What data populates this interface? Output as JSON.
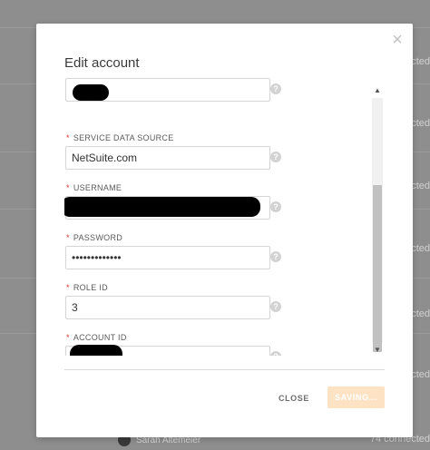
{
  "background": {
    "rows_status": [
      "nected",
      "nected",
      "nected",
      "nected",
      "nected",
      "nected"
    ],
    "user_name": "Sarah Altemeier",
    "user_status": "74 connected"
  },
  "modal": {
    "title": "Edit account",
    "fields": [
      {
        "label": "",
        "value": "",
        "redacted": true
      },
      {
        "label": "SERVICE DATA SOURCE",
        "value": "NetSuite.com",
        "redacted": false
      },
      {
        "label": "USERNAME",
        "value": "",
        "redacted": true
      },
      {
        "label": "PASSWORD",
        "value": "•••••••••••••",
        "redacted": false
      },
      {
        "label": "ROLE ID",
        "value": "3",
        "redacted": false
      },
      {
        "label": "ACCOUNT ID",
        "value": "",
        "redacted": true
      }
    ],
    "required_mark": "*",
    "help_icon": "?",
    "close_icon": "×",
    "buttons": {
      "close": "CLOSE",
      "saving": "SAVING..."
    }
  },
  "colors": {
    "accent_disabled": "#fde2c3",
    "required": "#e0312d"
  }
}
